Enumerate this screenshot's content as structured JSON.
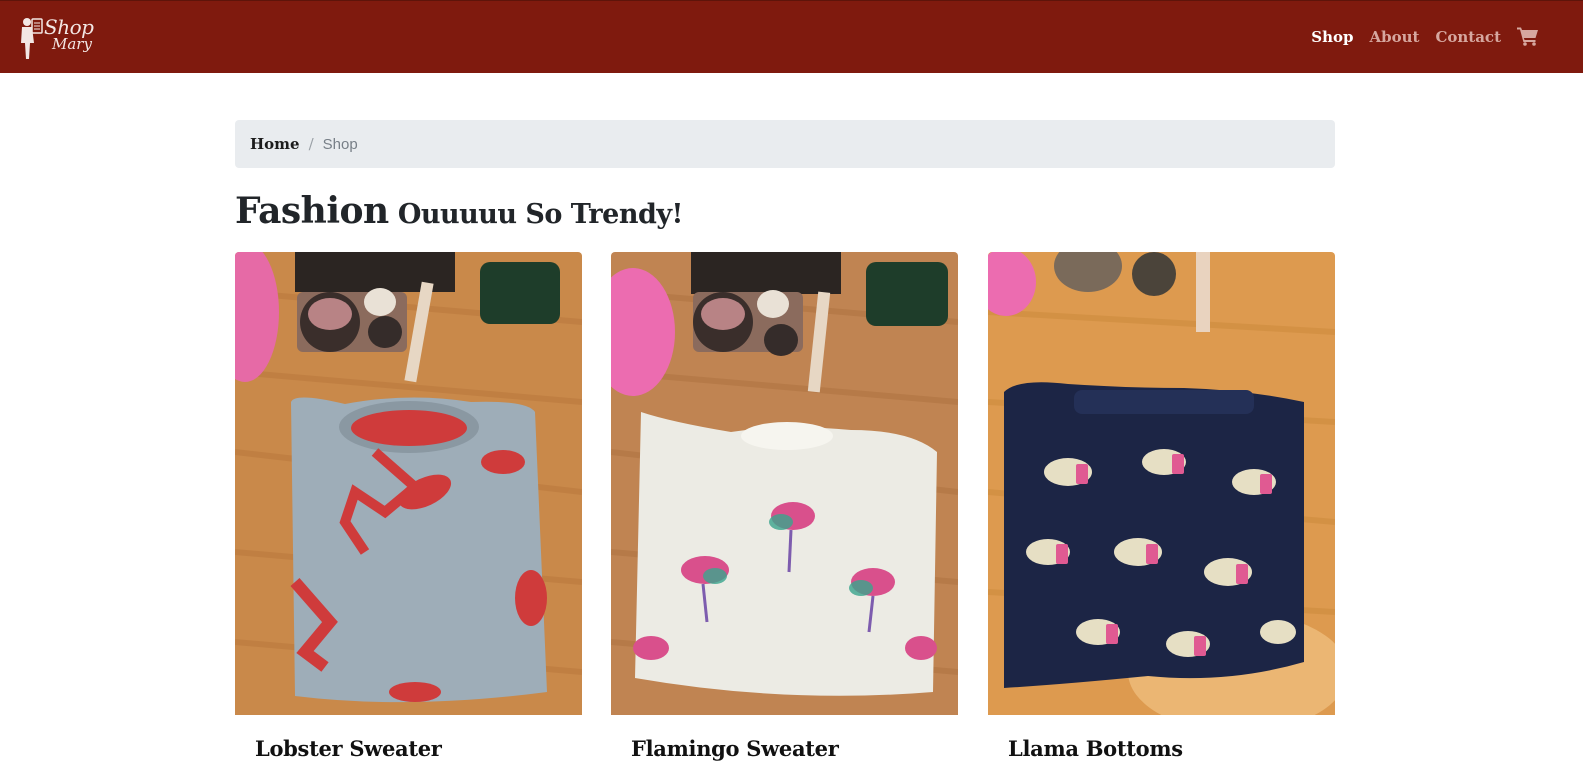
{
  "brand": {
    "logo_text_line1": "Shop",
    "logo_text_line2": "Mary",
    "navbar_color": "#7f1a0e"
  },
  "nav": {
    "links": [
      {
        "label": "Shop",
        "active": true
      },
      {
        "label": "About",
        "active": false
      },
      {
        "label": "Contact",
        "active": false
      }
    ],
    "cart_icon": "shopping-cart-icon"
  },
  "breadcrumb": {
    "home": "Home",
    "separator": "/",
    "current": "Shop"
  },
  "page": {
    "title": "Fashion",
    "subtitle": "Ouuuuu So Trendy!"
  },
  "products": [
    {
      "name": "Lobster Sweater",
      "image": "gray sweater with red lobster print on wooden table"
    },
    {
      "name": "Flamingo Sweater",
      "image": "white fuzzy sweater with rainbow flamingo print on wooden table"
    },
    {
      "name": "Llama Bottoms",
      "image": "navy pajama bottoms with llama print on wooden table"
    }
  ]
}
